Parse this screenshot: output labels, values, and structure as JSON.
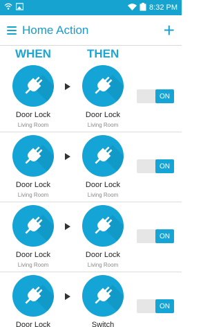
{
  "status_bar": {
    "time": "8:32 PM"
  },
  "app_bar": {
    "title": "Home Action",
    "add_label": "+"
  },
  "headers": {
    "when": "WHEN",
    "then": "THEN"
  },
  "rules": [
    {
      "when": {
        "device": "Door Lock",
        "room": "Living Room",
        "icon": "plug-icon"
      },
      "then": {
        "device": "Door Lock",
        "room": "Living Room",
        "icon": "plug-icon"
      },
      "toggle": "ON"
    },
    {
      "when": {
        "device": "Door Lock",
        "room": "Living Room",
        "icon": "plug-icon"
      },
      "then": {
        "device": "Door Lock",
        "room": "Living Room",
        "icon": "plug-icon"
      },
      "toggle": "ON"
    },
    {
      "when": {
        "device": "Door Lock",
        "room": "Living Room",
        "icon": "plug-icon"
      },
      "then": {
        "device": "Door Lock",
        "room": "Living Room",
        "icon": "plug-icon"
      },
      "toggle": "ON"
    },
    {
      "when": {
        "device": "Door Lock",
        "room": "",
        "icon": "plug-icon"
      },
      "then": {
        "device": "Switch",
        "room": "",
        "icon": "plug-icon"
      },
      "toggle": "ON"
    }
  ],
  "colors": {
    "accent": "#16a3cf",
    "circle": "#14a5d6",
    "toggle_off": "#e6e6e6"
  }
}
